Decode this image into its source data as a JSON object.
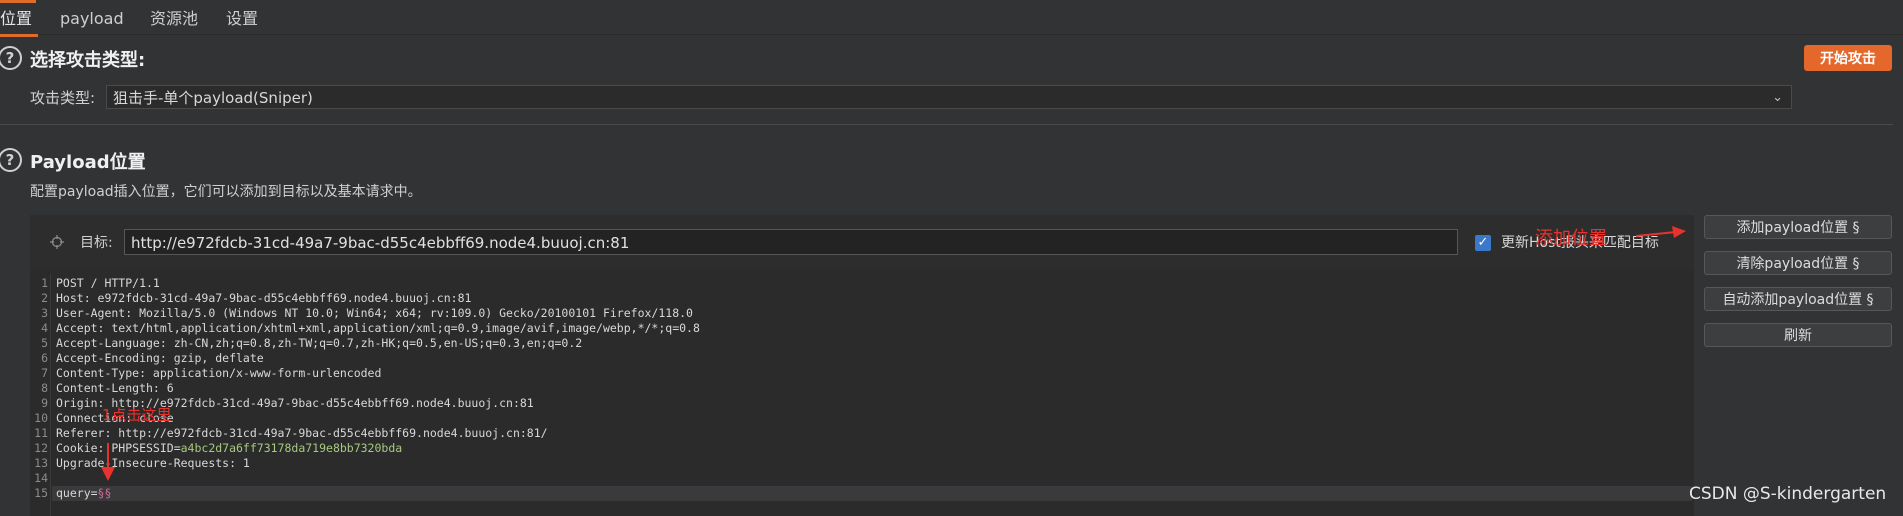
{
  "tabs": [
    {
      "label": "位置",
      "active": true
    },
    {
      "label": "payload",
      "active": false
    },
    {
      "label": "资源池",
      "active": false
    },
    {
      "label": "设置",
      "active": false
    }
  ],
  "attack_section": {
    "title": "选择攻击类型:",
    "type_label": "攻击类型:",
    "type_value": "狙击手-单个payload(Sniper)",
    "start_button": "开始攻击"
  },
  "payload_section": {
    "title": "Payload位置",
    "description": "配置payload插入位置，它们可以添加到目标以及基本请求中。",
    "target_label": "目标:",
    "target_url": "http://e972fdcb-31cd-49a7-9bac-d55c4ebbff69.node4.buuoj.cn:81",
    "update_host_label": "更新Host报头来匹配目标",
    "update_host_checked": true
  },
  "side_buttons": [
    "添加payload位置 §",
    "清除payload位置 §",
    "自动添加payload位置 §",
    "刷新"
  ],
  "request_lines": [
    {
      "n": "1",
      "text": "POST / HTTP/1.1"
    },
    {
      "n": "2",
      "text": "Host: e972fdcb-31cd-49a7-9bac-d55c4ebbff69.node4.buuoj.cn:81"
    },
    {
      "n": "3",
      "text": "User-Agent: Mozilla/5.0 (Windows NT 10.0; Win64; x64; rv:109.0) Gecko/20100101 Firefox/118.0"
    },
    {
      "n": "4",
      "text": "Accept: text/html,application/xhtml+xml,application/xml;q=0.9,image/avif,image/webp,*/*;q=0.8"
    },
    {
      "n": "5",
      "text": "Accept-Language: zh-CN,zh;q=0.8,zh-TW;q=0.7,zh-HK;q=0.5,en-US;q=0.3,en;q=0.2"
    },
    {
      "n": "6",
      "text": "Accept-Encoding: gzip, deflate"
    },
    {
      "n": "7",
      "text": "Content-Type: application/x-www-form-urlencoded"
    },
    {
      "n": "8",
      "text": "Content-Length: 6"
    },
    {
      "n": "9",
      "text": "Origin: http://e972fdcb-31cd-49a7-9bac-d55c4ebbff69.node4.buuoj.cn:81"
    },
    {
      "n": "10",
      "text": "Connection: close"
    },
    {
      "n": "11",
      "text": "Referer: http://e972fdcb-31cd-49a7-9bac-d55c4ebbff69.node4.buuoj.cn:81/"
    },
    {
      "n": "12",
      "key": "Cookie: PHPSESSID=",
      "value": "a4bc2d7a6ff73178da719e8bb7320bda"
    },
    {
      "n": "13",
      "text": "Upgrade-Insecure-Requests: 1"
    },
    {
      "n": "14",
      "text": ""
    },
    {
      "n": "15",
      "key": "query=",
      "marker": "§§"
    }
  ],
  "annotations": {
    "add_position": "添加位置",
    "click_here": "1点击这里"
  },
  "watermark": "CSDN @S-kindergarten",
  "colors": {
    "accent": "#e4672b",
    "annotation": "#e8322d",
    "checkbox": "#3a78c9",
    "cookie_value": "#a8c97f",
    "payload_marker": "#d86a9a"
  }
}
